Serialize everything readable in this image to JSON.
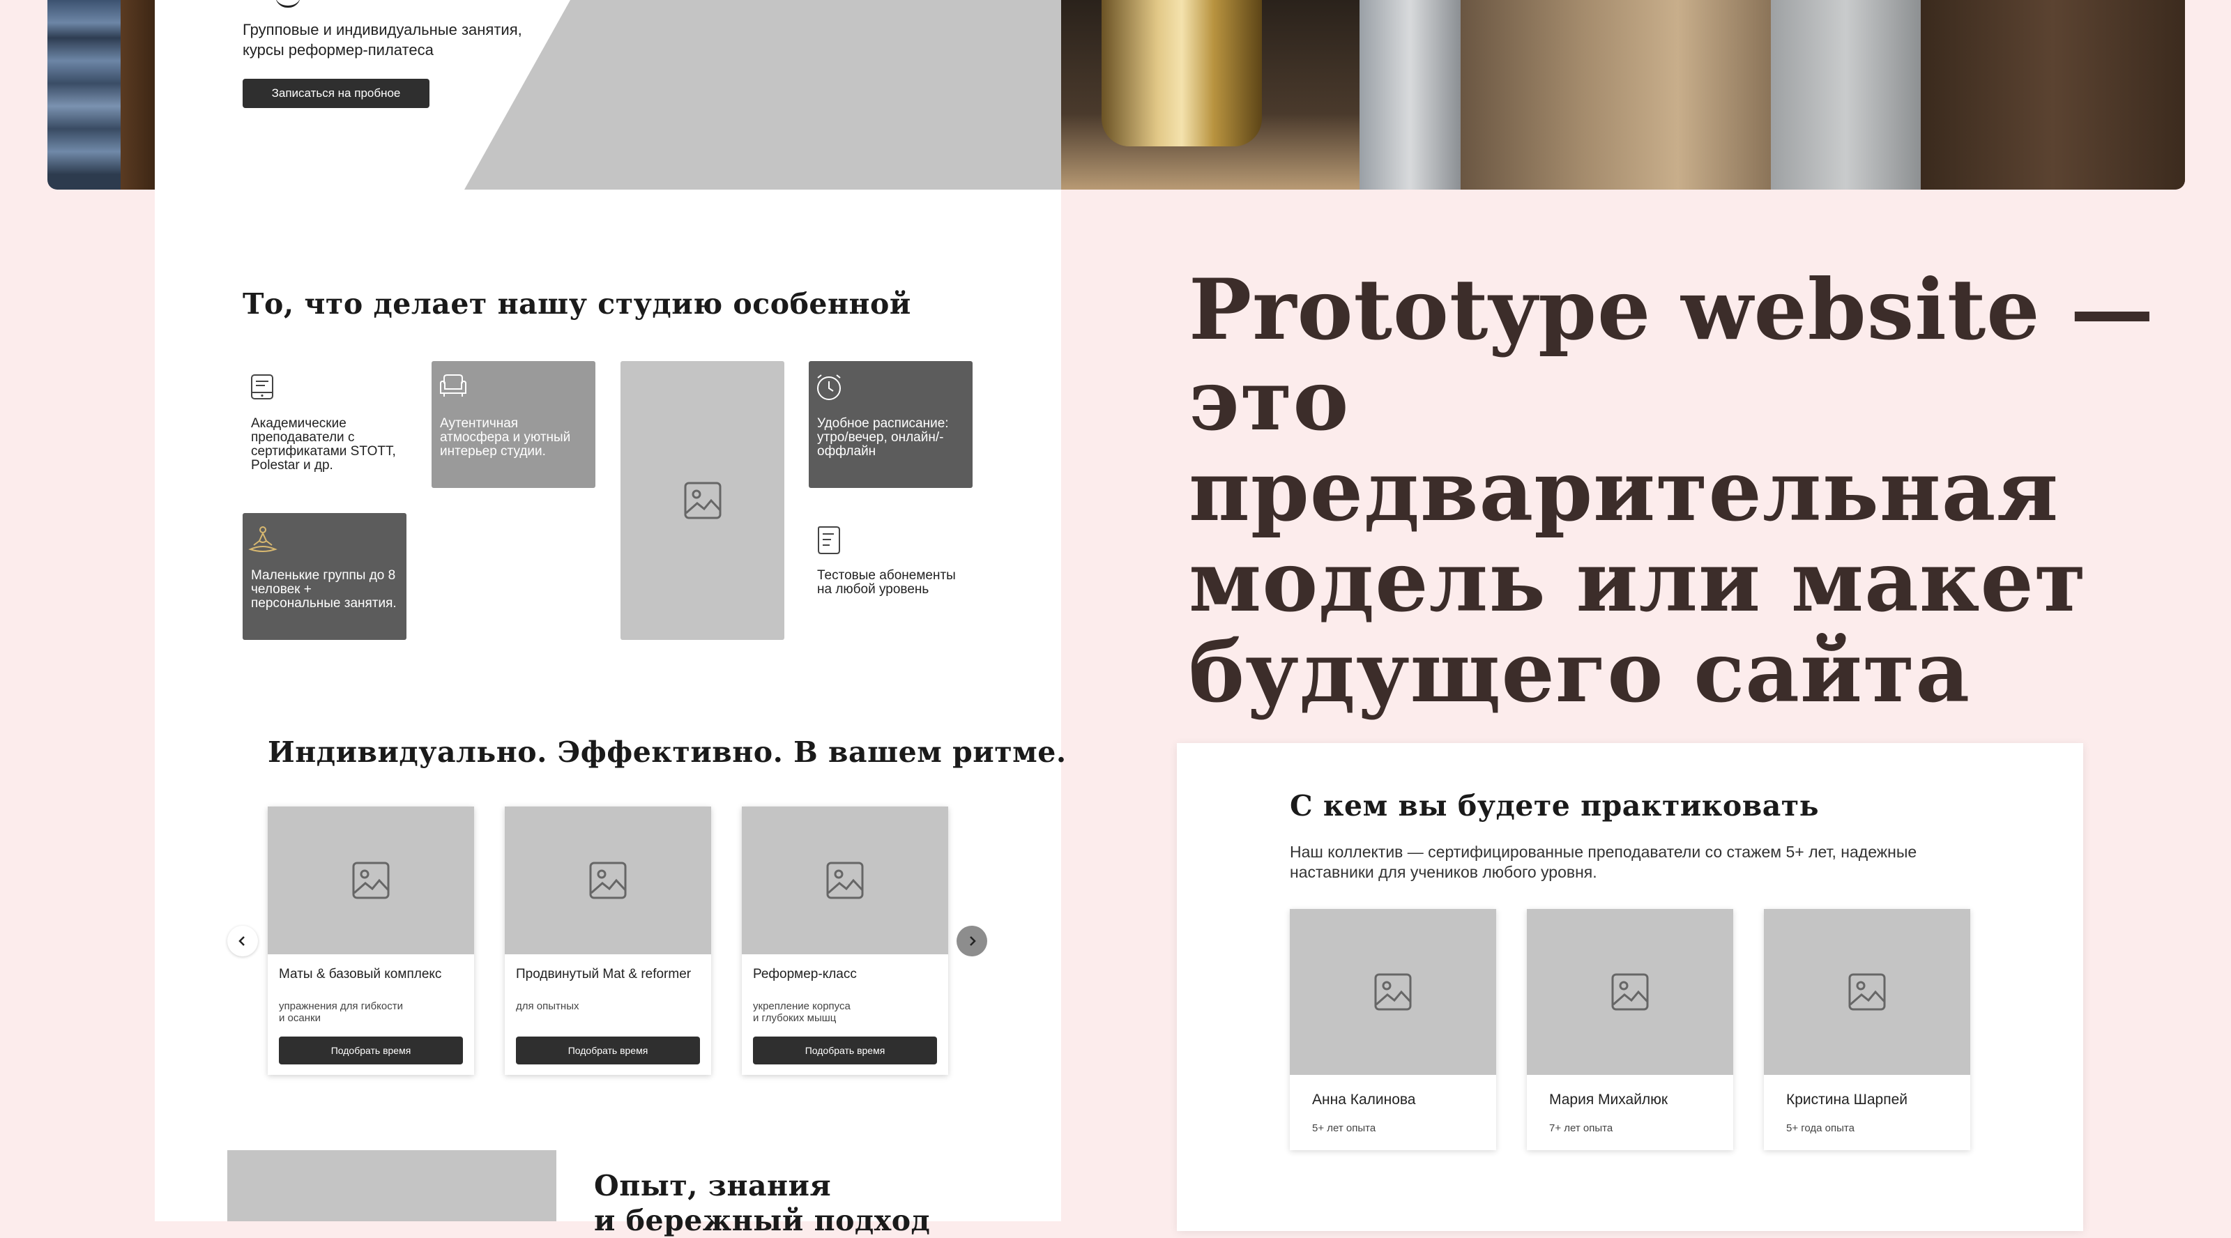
{
  "hero": {
    "subtitle_line1": "Групповые и индивидуальные занятия,",
    "subtitle_line2": "курсы реформер-пилатеса",
    "cta_label": "Записаться на пробное"
  },
  "features": {
    "heading": "То, что делает нашу студию особенной",
    "items": [
      {
        "text": "Академические преподаватели с сертификатами STOTT, Polestar и др.",
        "icon": "tablet-icon"
      },
      {
        "text": "Аутентичная атмосфера и уютный интерьер студии.",
        "icon": "armchair-icon"
      },
      {
        "text": "Удобное расписание: утро/вечер, онлайн/-оффлайн",
        "icon": "clock-icon"
      },
      {
        "text": "Маленькие группы до 8 человек + персональные занятия.",
        "icon": "meditation-icon"
      },
      {
        "text": "Тестовые абонементы на любой уровень",
        "icon": "receipt-icon"
      }
    ]
  },
  "programs": {
    "heading": "Индивидуально. Эффективно. В вашем ритме.",
    "cards": [
      {
        "title": "Маты & базовый комплекс",
        "desc_line1": "упражнения для гибкости",
        "desc_line2": "и осанки",
        "button": "Подобрать время"
      },
      {
        "title": "Продвинутый Mat & reformer",
        "desc_line1": "для опытных",
        "desc_line2": "",
        "button": "Подобрать время"
      },
      {
        "title": "Реформер-класс",
        "desc_line1": "укрепление корпуса",
        "desc_line2": "и глубоких мышц",
        "button": "Подобрать время"
      }
    ]
  },
  "experience": {
    "heading_line1": "Опыт, знания",
    "heading_line2": "и бережный подход"
  },
  "prototype": {
    "line1": "Prototype website —",
    "line2": "это предварительная",
    "line3": "модель или макет",
    "line4": "будущего сайта"
  },
  "team": {
    "heading": "С кем вы будете практиковать",
    "desc_line1": "Наш коллектив — сертифицированные преподаватели со стажем 5+ лет, надежные",
    "desc_line2": "наставники для учеников любого уровня.",
    "members": [
      {
        "name": "Анна Калинова",
        "experience": "5+ лет опыта"
      },
      {
        "name": "Мария Михайлюк",
        "experience": "7+ лет опыта"
      },
      {
        "name": "Кристина Шарпей",
        "experience": "5+ года опыта"
      }
    ]
  },
  "colors": {
    "page_background": "#fcecec",
    "dark_button": "#2f2f2f",
    "placeholder_grey": "#c4c4c4",
    "heading_brown": "#3c2d2a"
  }
}
